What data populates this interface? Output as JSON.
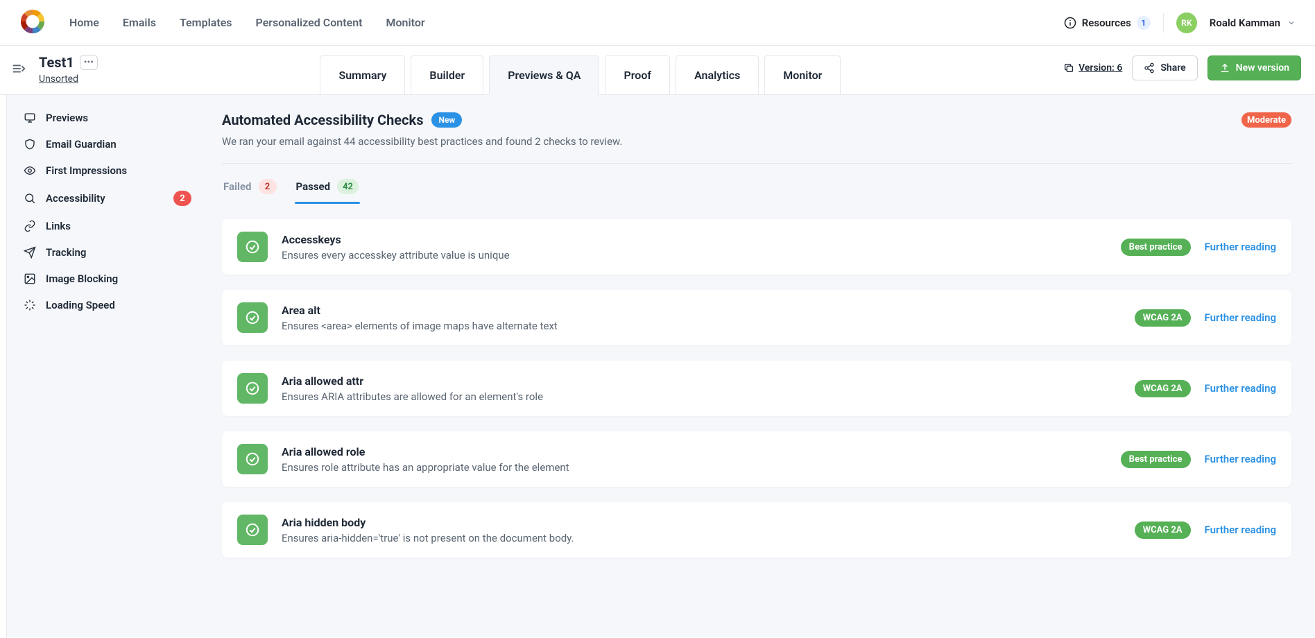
{
  "topnav": {
    "items": [
      "Home",
      "Emails",
      "Templates",
      "Personalized Content",
      "Monitor"
    ],
    "resources": "Resources",
    "resources_count": "1",
    "user_initials": "RK",
    "user_name": "Roald Kamman"
  },
  "subheader": {
    "title": "Test1",
    "subtitle": "Unsorted",
    "tabs": [
      "Summary",
      "Builder",
      "Previews & QA",
      "Proof",
      "Analytics",
      "Monitor"
    ],
    "active_tab_index": 2,
    "version": "Version: 6",
    "share": "Share",
    "new_version": "New version"
  },
  "sidebar": {
    "items": [
      {
        "label": "Previews"
      },
      {
        "label": "Email Guardian"
      },
      {
        "label": "First Impressions"
      },
      {
        "label": "Accessibility",
        "badge": "2"
      },
      {
        "label": "Links"
      },
      {
        "label": "Tracking"
      },
      {
        "label": "Image Blocking"
      },
      {
        "label": "Loading Speed"
      }
    ]
  },
  "section": {
    "title": "Automated Accessibility Checks",
    "new": "New",
    "severity": "Moderate",
    "description": "We ran your email against 44 accessibility best practices and found 2 checks to review."
  },
  "result_tabs": {
    "failed_label": "Failed",
    "failed_count": "2",
    "passed_label": "Passed",
    "passed_count": "42"
  },
  "further_reading": "Further reading",
  "checks": [
    {
      "title": "Accesskeys",
      "desc": "Ensures every accesskey attribute value is unique",
      "tag": "Best practice"
    },
    {
      "title": "Area alt",
      "desc": "Ensures <area> elements of image maps have alternate text",
      "tag": "WCAG 2A"
    },
    {
      "title": "Aria allowed attr",
      "desc": "Ensures ARIA attributes are allowed for an element's role",
      "tag": "WCAG 2A"
    },
    {
      "title": "Aria allowed role",
      "desc": "Ensures role attribute has an appropriate value for the element",
      "tag": "Best practice"
    },
    {
      "title": "Aria hidden body",
      "desc": "Ensures aria-hidden='true' is not present on the document body.",
      "tag": "WCAG 2A"
    }
  ]
}
